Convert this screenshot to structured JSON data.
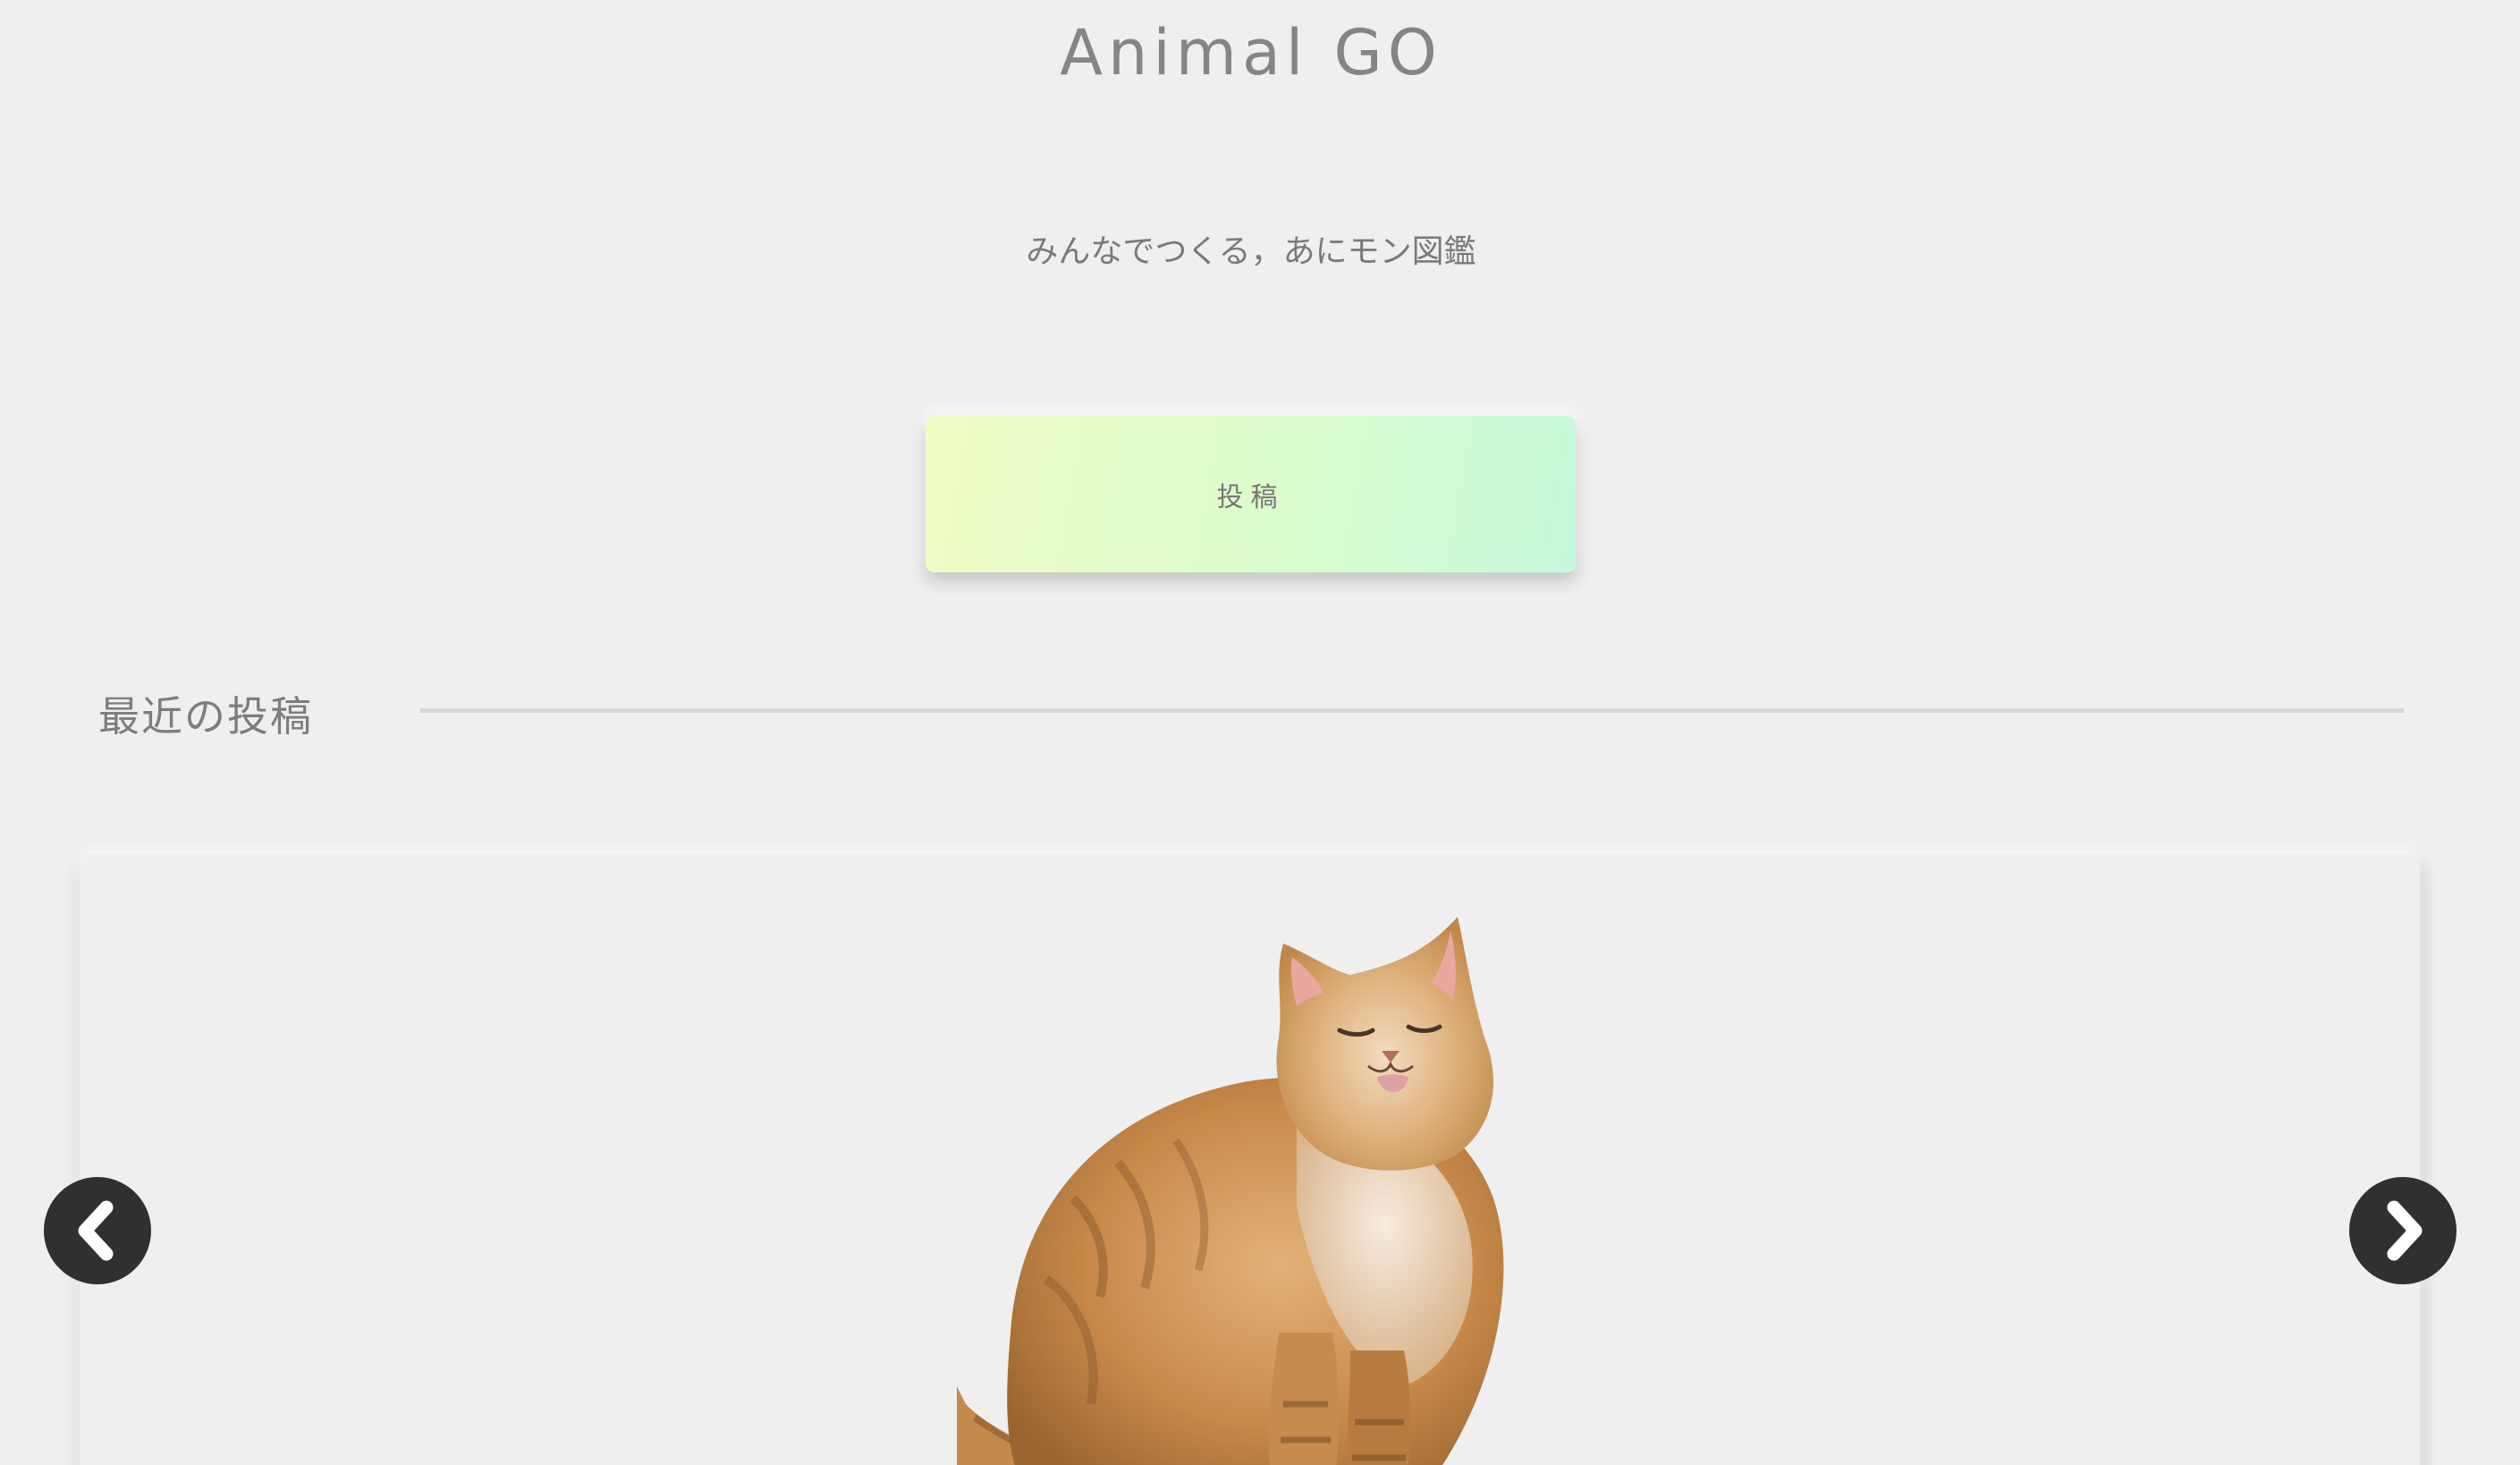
{
  "header": {
    "title": "Animal GO",
    "tagline": "みんなでつくる，あにモン図鑑"
  },
  "actions": {
    "post_label": "投稿"
  },
  "recent": {
    "heading": "最近の投稿",
    "current_item": {
      "image_subject": "cat"
    }
  },
  "carousel": {
    "prev_icon": "chevron-left-icon",
    "next_icon": "chevron-right-icon"
  },
  "colors": {
    "background": "#efefef",
    "text": "#7d7d7d",
    "button_gradient_start": "#f0fcc6",
    "button_gradient_end": "#c6fadc",
    "arrow": "#303030"
  }
}
